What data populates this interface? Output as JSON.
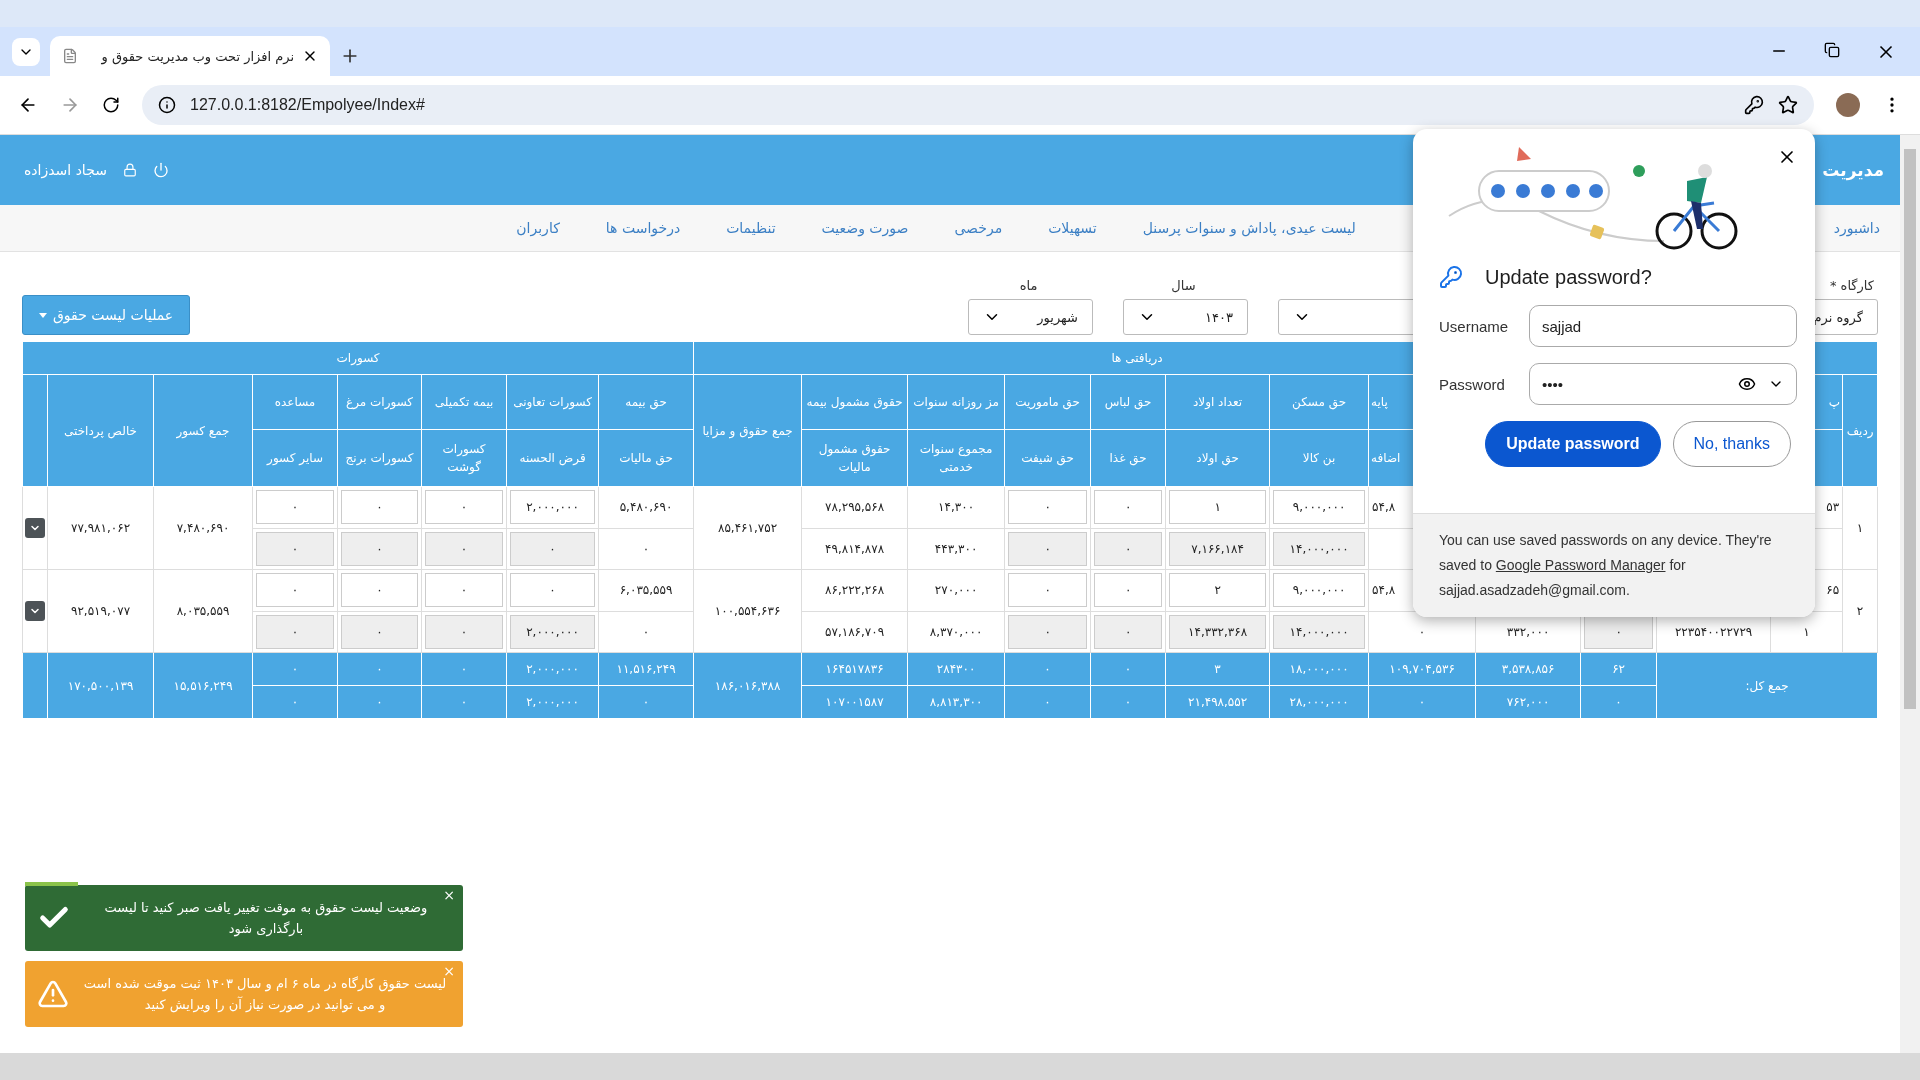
{
  "browser": {
    "tab_title": "نرم افزار تحت وب مدیریت حقوق و",
    "url": "127.0.0.1:8182/Empolyee/Index#"
  },
  "header": {
    "title": "مدیریت",
    "user": "سجاد اسدزاده"
  },
  "nav": [
    "داشبورد",
    "لیست عیدی، پاداش و سنوات پرسنل",
    "تسهیلات",
    "مرخصی",
    "صورت وضعیت",
    "تنظیمات",
    "درخواست ها",
    "کاربران"
  ],
  "filters": [
    {
      "kind": "cut_select",
      "label": "کارگاه *",
      "value": "گروه نرم"
    },
    {
      "kind": "blank"
    },
    {
      "kind": "select",
      "label": "سال",
      "value": "۱۴۰۳"
    },
    {
      "kind": "select",
      "label": "ماه",
      "value": "شهریور"
    }
  ],
  "actions_button": "عملیات لیست حقوق",
  "table": {
    "groups": [
      {
        "kind": "blank",
        "columns": [
          {
            "kind": "rownum",
            "label": "ردیف"
          },
          {
            "kind": "cut_right",
            "top": "پ"
          },
          {
            "kind": "plain"
          },
          {
            "kind": "input"
          }
        ]
      },
      {
        "kind": "label",
        "label": "دریافتی ها",
        "columns": [
          {
            "kind": "plain"
          },
          {
            "kind": "cut_left",
            "top": "پایه",
            "bottom": "اضافه"
          },
          {
            "kind": "input",
            "top": "حق مسکن",
            "bottom": "بن کالا"
          },
          {
            "kind": "input",
            "top": "تعداد اولاد",
            "bottom": "حق اولاد"
          },
          {
            "kind": "input",
            "top": "حق لباس",
            "bottom": "حق غذا"
          },
          {
            "kind": "input",
            "top": "حق ماموریت",
            "bottom": "حق شیفت"
          },
          {
            "kind": "plain",
            "top": "مز روزانه سنوات",
            "bottom": "مجموع سنوات خدمتی"
          },
          {
            "kind": "plain",
            "top": "حقوق مشمول بیمه",
            "bottom": "حقوق مشمول مالیات"
          },
          {
            "kind": "merged",
            "label": "جمع حقوق و مزایا"
          }
        ]
      },
      {
        "kind": "label",
        "label": "کسورات",
        "columns": [
          {
            "kind": "plain",
            "top": "حق بیمه",
            "bottom": "حق مالیات"
          },
          {
            "kind": "input",
            "top": "کسورات تعاونی",
            "bottom": "قرض الحسنه"
          },
          {
            "kind": "input",
            "top": "بیمه تکمیلی",
            "bottom": "کسورات گوشت"
          },
          {
            "kind": "input",
            "top": "کسورات مرغ",
            "bottom": "کسورات برنج"
          },
          {
            "kind": "input",
            "top": "مساعده",
            "bottom": "سایر کسور"
          },
          {
            "kind": "merged",
            "label": "جمع کسور"
          },
          {
            "kind": "merged",
            "label": "خالص پرداختی"
          },
          {
            "kind": "toggle"
          }
        ]
      }
    ],
    "rows": [
      {
        "sub_disabled": true,
        "cells": [
          {
            "value": "۱"
          },
          {
            "main": "۵۳"
          },
          {},
          {},
          {},
          {
            "main": "۵۴,۸"
          },
          {
            "main": "۹,۰۰۰,۰۰۰",
            "sub": "۱۴,۰۰۰,۰۰۰"
          },
          {
            "main": "۱",
            "sub": "۷,۱۶۶,۱۸۴"
          },
          {
            "main": "۰",
            "sub": "۰"
          },
          {
            "main": "۰",
            "sub": "۰"
          },
          {
            "main": "۱۴,۳۰۰",
            "sub": "۴۴۳,۳۰۰"
          },
          {
            "main": "۷۸,۲۹۵,۵۶۸",
            "sub": "۴۹,۸۱۴,۸۷۸"
          },
          {
            "value": "۸۵,۴۶۱,۷۵۲"
          },
          {
            "main": "۵,۴۸۰,۶۹۰",
            "sub": "۰"
          },
          {
            "main": "۲,۰۰۰,۰۰۰",
            "sub": "۰"
          },
          {
            "main": "۰",
            "sub": "۰"
          },
          {
            "main": "۰",
            "sub": "۰"
          },
          {
            "main": "۰",
            "sub": "۰"
          },
          {
            "value": "۷,۴۸۰,۶۹۰"
          },
          {
            "value": "۷۷,۹۸۱,۰۶۲"
          }
        ]
      },
      {
        "sub_disabled": true,
        "cells": [
          {
            "value": "۲"
          },
          {
            "main": "۶۵",
            "sub": "۱"
          },
          {
            "sub": "۲۲۳۵۴۰۰۲۲۷۲۹"
          },
          {
            "sub": "۰"
          },
          {
            "sub": "۳۳۲,۰۰۰"
          },
          {
            "main": "۵۴,۸",
            "sub": "۰"
          },
          {
            "main": "۹,۰۰۰,۰۰۰",
            "sub": "۱۴,۰۰۰,۰۰۰"
          },
          {
            "main": "۲",
            "sub": "۱۴,۳۳۲,۳۶۸"
          },
          {
            "main": "۰",
            "sub": "۰"
          },
          {
            "main": "۰",
            "sub": "۰"
          },
          {
            "main": "۲۷۰,۰۰۰",
            "sub": "۸,۳۷۰,۰۰۰"
          },
          {
            "main": "۸۶,۲۲۲,۲۶۸",
            "sub": "۵۷,۱۸۶,۷۰۹"
          },
          {
            "value": "۱۰۰,۵۵۴,۶۳۶"
          },
          {
            "main": "۶,۰۳۵,۵۵۹",
            "sub": "۰"
          },
          {
            "main": "۰",
            "sub": "۲,۰۰۰,۰۰۰"
          },
          {
            "main": "۰",
            "sub": "۰"
          },
          {
            "main": "۰",
            "sub": "۰"
          },
          {
            "main": "۰",
            "sub": "۰"
          },
          {
            "value": "۸,۰۳۵,۵۵۹"
          },
          {
            "value": "۹۲,۵۱۹,۰۷۷"
          }
        ]
      }
    ],
    "totals": {
      "label": "جمع کل:",
      "cells": [
        {
          "main": "۶۲",
          "sub": "۰"
        },
        {
          "main": "۳,۵۳۸,۸۵۶",
          "sub": "۷۶۲,۰۰۰"
        },
        {
          "main": "۱۰۹,۷۰۴,۵۳۶",
          "sub": "۰"
        },
        {
          "main": "۱۸,۰۰۰,۰۰۰",
          "sub": "۲۸,۰۰۰,۰۰۰"
        },
        {
          "main": "۳",
          "sub": "۲۱,۴۹۸,۵۵۲"
        },
        {
          "main": "۰",
          "sub": "۰"
        },
        {
          "main": "۰",
          "sub": "۰"
        },
        {
          "main": "۲۸۴۳۰۰",
          "sub": "۸,۸۱۳,۳۰۰"
        },
        {
          "main": "۱۶۴۵۱۷۸۳۶",
          "sub": "۱۰۷۰۰۱۵۸۷"
        },
        {
          "value": "۱۸۶,۰۱۶,۳۸۸"
        },
        {
          "main": "۱۱,۵۱۶,۲۴۹",
          "sub": "۰"
        },
        {
          "main": "۲,۰۰۰,۰۰۰",
          "sub": "۲,۰۰۰,۰۰۰"
        },
        {
          "main": "۰",
          "sub": "۰"
        },
        {
          "main": "۰",
          "sub": "۰"
        },
        {
          "main": "۰",
          "sub": "۰"
        },
        {
          "value": "۱۵,۵۱۶,۲۴۹"
        },
        {
          "value": "۱۷۰,۵۰۰,۱۳۹"
        }
      ]
    }
  },
  "password_popup": {
    "title": "Update password?",
    "username_label": "Username",
    "username": "sajjad",
    "password_label": "Password",
    "password_mask": "••••",
    "primary_button": "Update password",
    "secondary_button": "No, thanks",
    "footer_before": "You can use saved passwords on any device. They're saved to",
    "footer_link": "Google Password Manager",
    "footer_after": "for sajjad.asadzadeh@gmail.com."
  },
  "toasts": [
    {
      "kind": "success",
      "text": "وضعیت لیست حقوق به موقت تغییر یافت صبر کنید تا لیست بارگذاری شود",
      "close": "×",
      "level": 0.12
    },
    {
      "kind": "warning",
      "text": "لیست حقوق کارگاه در ماه ۶ ام و سال ۱۴۰۳ ثبت موقت شده است و می توانید در صورت نیاز آن را ویرایش کنید",
      "close": "×"
    }
  ]
}
